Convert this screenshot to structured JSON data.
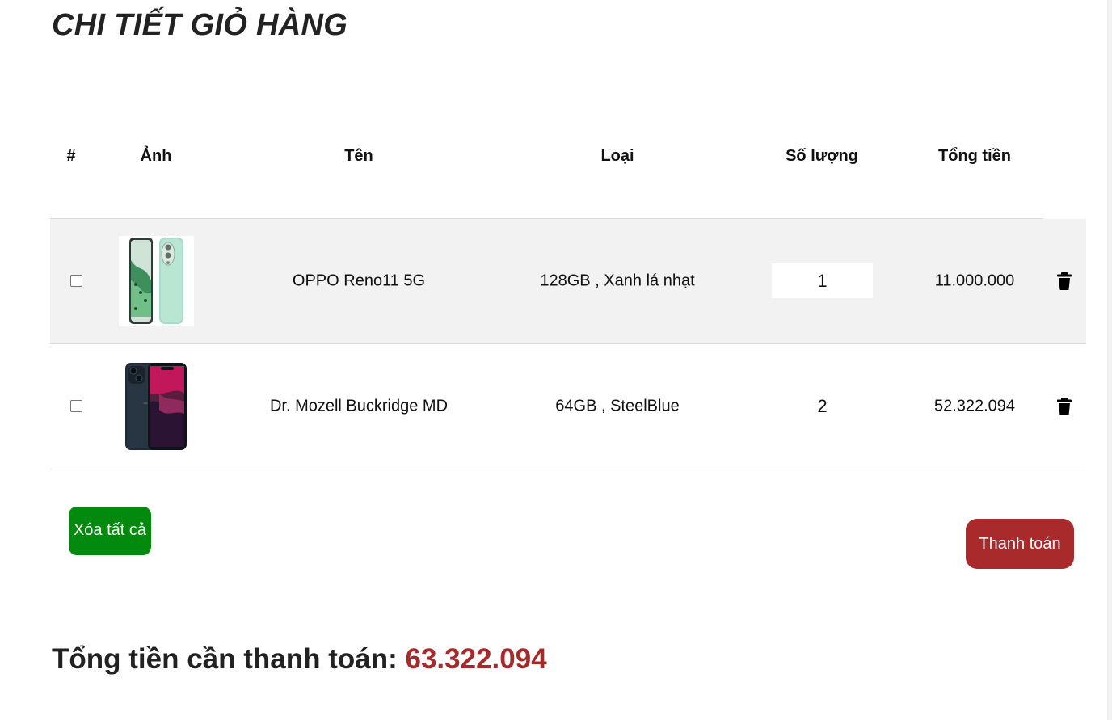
{
  "page": {
    "title": "CHI TIẾT GIỎ HÀNG"
  },
  "table": {
    "headers": {
      "index": "#",
      "image": "Ảnh",
      "name": "Tên",
      "variant": "Loại",
      "quantity": "Số lượng",
      "total": "Tổng tiền"
    },
    "rows": [
      {
        "selected": false,
        "image_icon": "phone-oppo-reno11-green-icon",
        "name": "OPPO Reno11 5G",
        "variant": "128GB , Xanh lá nhạt",
        "quantity": "1",
        "total": "11.000.000"
      },
      {
        "selected": false,
        "image_icon": "phone-iphone-dark-icon",
        "name": "Dr. Mozell Buckridge MD",
        "variant": "64GB , SteelBlue",
        "quantity": "2",
        "total": "52.322.094"
      }
    ]
  },
  "actions": {
    "clear_all_label": "Xóa tất cả",
    "checkout_label": "Thanh toán"
  },
  "summary": {
    "label": "Tổng tiền cần thanh toán:",
    "amount": "63.322.094"
  },
  "colors": {
    "clear_button": "#028a0f",
    "checkout_button": "#a92a2a",
    "total_amount": "#a52a2a",
    "shaded_row": "#f2f2f2"
  }
}
